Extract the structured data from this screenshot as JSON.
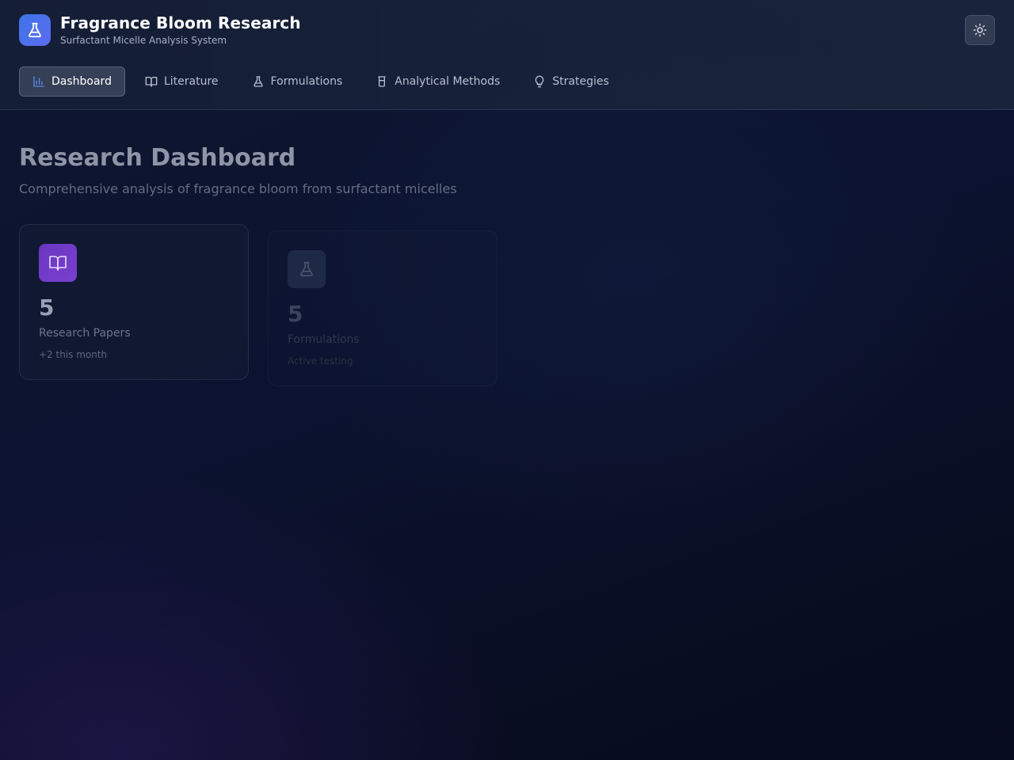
{
  "header": {
    "title": "Fragrance Bloom Research",
    "subtitle": "Surfactant Micelle Analysis System",
    "brand_icon": "flask-icon",
    "theme_toggle_icon": "sun-icon"
  },
  "nav": {
    "items": [
      {
        "label": "Dashboard",
        "icon": "bar-chart-icon",
        "active": true
      },
      {
        "label": "Literature",
        "icon": "book-icon",
        "active": false
      },
      {
        "label": "Formulations",
        "icon": "flask-icon",
        "active": false
      },
      {
        "label": "Analytical Methods",
        "icon": "test-tube-icon",
        "active": false
      },
      {
        "label": "Strategies",
        "icon": "lightbulb-icon",
        "active": false
      }
    ]
  },
  "main": {
    "title": "Research Dashboard",
    "subtitle": "Comprehensive analysis of fragrance bloom from surfactant micelles",
    "stats": [
      {
        "value": "5",
        "label": "Research Papers",
        "note": "+2 this month",
        "icon": "book-icon",
        "color": "#6a37c0"
      },
      {
        "value": "5",
        "label": "Formulations",
        "note": "Active testing",
        "icon": "flask-icon",
        "color": "#2d3c55"
      }
    ]
  },
  "colors": {
    "accent": "#3e74e8",
    "background": "#0b1330"
  }
}
